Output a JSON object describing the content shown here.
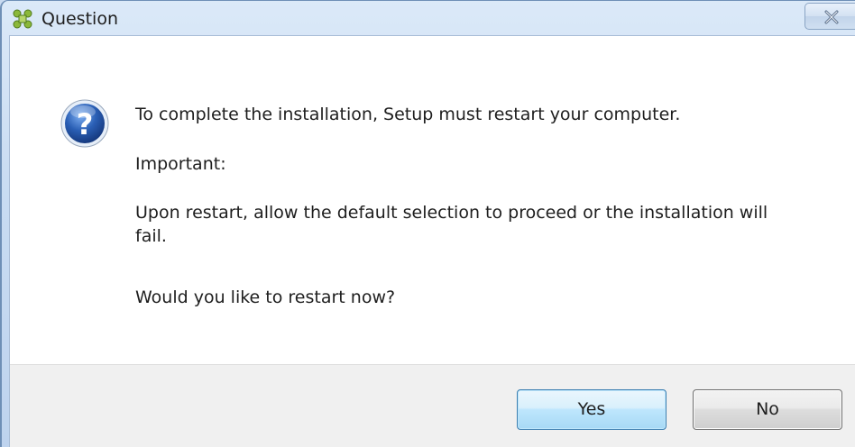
{
  "window": {
    "title": "Question",
    "app_icon": "setup-app-icon",
    "close_icon": "close-icon"
  },
  "dialog": {
    "icon": "question-icon",
    "message_line1": "To complete the installation, Setup must restart your computer.",
    "message_line2": "Important:",
    "message_line3": "Upon restart, allow the default selection to proceed or the installation will fail.",
    "message_line4": "Would you like to restart now?"
  },
  "buttons": {
    "yes_label": "Yes",
    "no_label": "No"
  },
  "colors": {
    "title_bar": "#c9dcf2",
    "client_background": "#ffffff",
    "footer_background": "#f0f0f0",
    "default_button_border": "#3c7fb1",
    "icon_blue": "#2a5fb5"
  }
}
